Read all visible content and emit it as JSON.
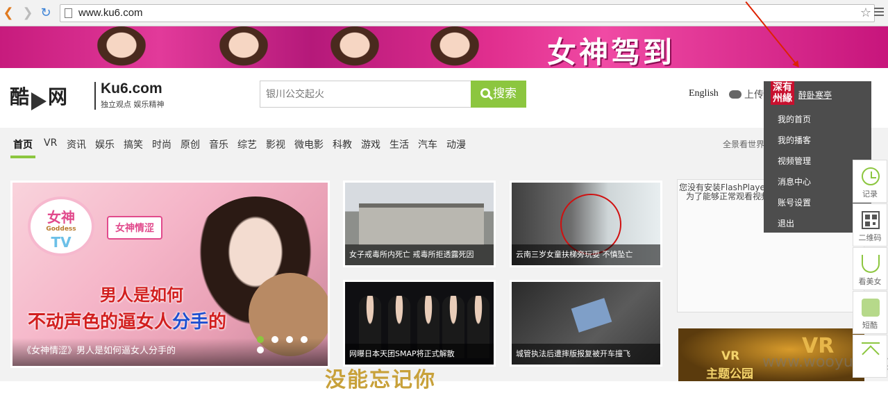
{
  "browser": {
    "url": "www.ku6.com",
    "back_icon": "back-arrow-icon",
    "forward_icon": "forward-arrow-icon",
    "reload_icon": "reload-icon"
  },
  "banner": {
    "title": "女神驾到"
  },
  "header": {
    "logo_cn": "酷",
    "logo_cn2": "网",
    "logo_en": "Ku6.com",
    "slogan": "独立观点 娱乐精神",
    "search_placeholder": "银川公交起火",
    "search_button": "搜索",
    "english": "English",
    "upload": "上传"
  },
  "user_menu": {
    "avatar_text": "深有\n州緣",
    "username": "醉卧寒亭",
    "items": [
      "我的首页",
      "我的播客",
      "视频管理",
      "消息中心",
      "账号设置",
      "退出"
    ]
  },
  "nav": {
    "tabs": [
      "首页",
      "VR",
      "资讯",
      "娱乐",
      "搞笑",
      "时尚",
      "原创",
      "音乐",
      "综艺",
      "影视",
      "微电影",
      "科教",
      "游戏",
      "生活",
      "汽车",
      "动漫"
    ],
    "active": "首页",
    "right_text": "全景看世界"
  },
  "hero": {
    "tv_top": "女神",
    "tv_mid": "Goddess",
    "tv_bottom": "TV",
    "badge": "女神情涩",
    "line1": "男人是如何",
    "line2_a": "不动声色的逼女人",
    "line2_b": "分手",
    "line2_c": "的",
    "caption": "《女神情涩》男人是如何逼女人分手的",
    "dots": 5,
    "active_dot": 0
  },
  "thumbs": [
    {
      "caption": "女子戒毒所内死亡 戒毒所拒透露死因"
    },
    {
      "caption": "云南三岁女童扶梯旁玩耍 不慎坠亡"
    },
    {
      "caption": "网曝日本天团SMAP将正式解散"
    },
    {
      "caption": "城管执法后遭摔版报复被开车撞飞"
    }
  ],
  "flash_notice": {
    "line1": "您没有安装FlashPlayer或",
    "line2": "为了能够正常观看视频"
  },
  "vr_ad": {
    "line1": "VR",
    "line2": "主题公园"
  },
  "watermark": "www.wooyun.org",
  "bottom_text": "没能忘记你",
  "toolbar": [
    {
      "icon": "clock-icon",
      "label": "记录"
    },
    {
      "icon": "qrcode-icon",
      "label": "二维码"
    },
    {
      "icon": "bra-icon",
      "label": "看美女"
    },
    {
      "icon": "cube-icon",
      "label": "短酷"
    },
    {
      "icon": "back-to-top-icon",
      "label": ""
    }
  ]
}
